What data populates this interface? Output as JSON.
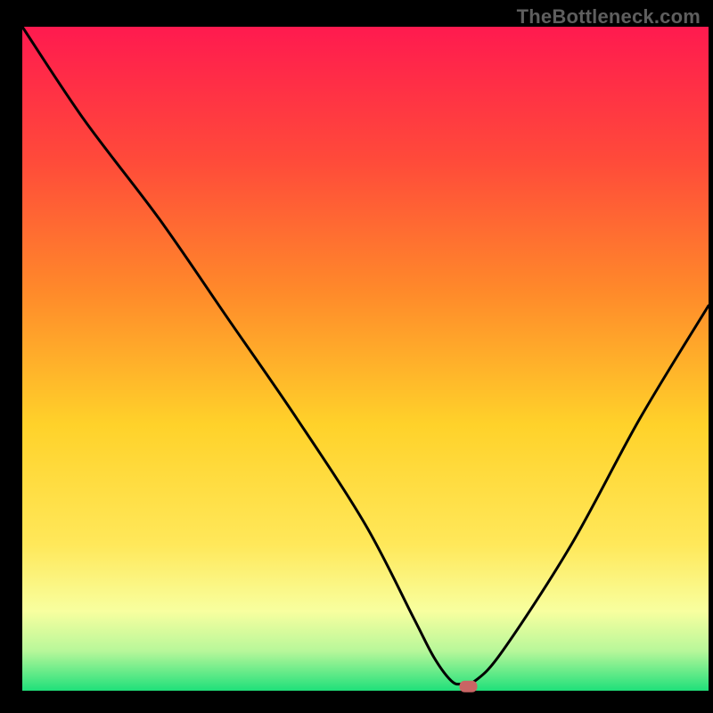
{
  "watermark": "TheBottleneck.com",
  "chart_data": {
    "type": "line",
    "title": "",
    "xlabel": "",
    "ylabel": "",
    "xlim": [
      0,
      100
    ],
    "ylim": [
      0,
      100
    ],
    "grid": false,
    "series": [
      {
        "name": "bottleneck-curve",
        "x": [
          0,
          9,
          20,
          30,
          40,
          50,
          57,
          60,
          62.5,
          64,
          66,
          70,
          80,
          90,
          100
        ],
        "values": [
          100,
          86,
          71,
          56,
          41,
          25,
          11,
          5,
          1.5,
          1,
          1.5,
          6,
          22,
          41,
          58
        ]
      }
    ],
    "annotations": [
      {
        "name": "marker",
        "shape": "rounded-rect",
        "x": 65,
        "y": 0.7,
        "color": "#c96464"
      }
    ],
    "colors": {
      "gradient_top": "#ff1a4f",
      "gradient_mid_upper": "#ff8a2a",
      "gradient_mid": "#ffe22a",
      "gradient_lower": "#f8ff9f",
      "gradient_bottom": "#1fe07a",
      "curve": "#000000",
      "marker": "#c96464",
      "frame": "#000000"
    }
  }
}
